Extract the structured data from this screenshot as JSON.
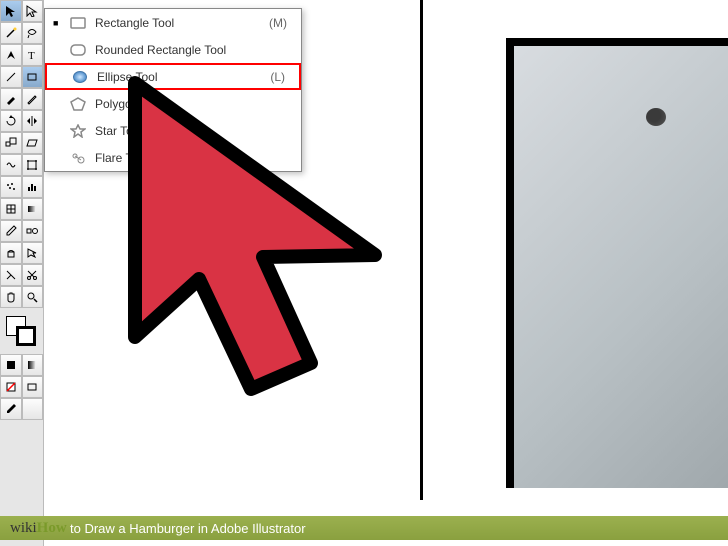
{
  "popup": {
    "items": [
      {
        "label": "Rectangle Tool",
        "shortcut": "(M)",
        "selected": false
      },
      {
        "label": "Rounded Rectangle Tool",
        "shortcut": "",
        "selected": false
      },
      {
        "label": "Ellipse Tool",
        "shortcut": "(L)",
        "selected": true
      },
      {
        "label": "Polygon",
        "shortcut": "",
        "selected": false
      },
      {
        "label": "Star Tool",
        "shortcut": "",
        "selected": false
      },
      {
        "label": "Flare Tool",
        "shortcut": "",
        "selected": false
      }
    ]
  },
  "caption": {
    "brand_prefix": "wiki",
    "brand_suffix": "How",
    "text": " to Draw a Hamburger in Adobe Illustrator"
  },
  "colors": {
    "highlight": "#f00000",
    "cursor_fill": "#d93344",
    "bar": "#90a843"
  }
}
